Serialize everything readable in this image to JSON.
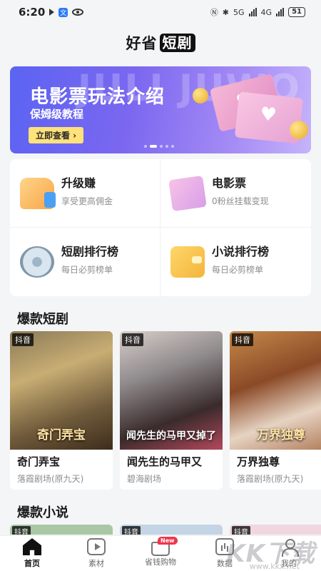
{
  "status_bar": {
    "time": "6:20",
    "badge_text": "文",
    "network": "5G",
    "network2": "4G",
    "battery": "51"
  },
  "header": {
    "brand_left": "好省",
    "brand_box": "短剧"
  },
  "banner": {
    "watermark": "JULI JUWO",
    "title": "电影票玩法介绍",
    "subtitle": "保姆级教程",
    "button": "立即查看 ›",
    "slides": 5,
    "active_slide": 1
  },
  "features": [
    {
      "title": "升级赚",
      "sub": "享受更高佣金",
      "icon": "thumbs-up-icon"
    },
    {
      "title": "电影票",
      "sub": "0粉丝挂载变现",
      "icon": "movie-ticket-icon"
    },
    {
      "title": "短剧排行榜",
      "sub": "每日必剪榜单",
      "icon": "film-reel-icon"
    },
    {
      "title": "小说排行榜",
      "sub": "每日必剪榜单",
      "icon": "wallet-icon"
    }
  ],
  "sections": {
    "drama": "爆款短剧",
    "novel": "爆款小说"
  },
  "dramas": [
    {
      "tag": "抖音",
      "poster_text": "奇门弄宝",
      "title": "奇门弄宝",
      "source": "落霞剧场(原九天)"
    },
    {
      "tag": "抖音",
      "poster_text": "闻先生的马甲又掉了",
      "title": "闻先生的马甲又",
      "source": "碧海剧场"
    },
    {
      "tag": "抖音",
      "poster_text": "万界独尊",
      "title": "万界独尊",
      "source": "落霞剧场(原九天)"
    }
  ],
  "novels": [
    {
      "tag": "抖音"
    },
    {
      "tag": "抖音"
    },
    {
      "tag": "抖音"
    }
  ],
  "tabs": [
    {
      "label": "首页",
      "icon": "home-icon",
      "active": true
    },
    {
      "label": "素材",
      "icon": "play-icon"
    },
    {
      "label": "省钱购物",
      "icon": "shopping-bag-icon",
      "badge": "New"
    },
    {
      "label": "数据",
      "icon": "chart-icon"
    },
    {
      "label": "我的",
      "icon": "user-icon"
    }
  ],
  "watermark": {
    "text": "KK下载",
    "sub": "www.kkx.net"
  },
  "colors": {
    "accent": "#5b64f2",
    "banner_button": "#ffe27a",
    "badge": "#f0364a"
  }
}
